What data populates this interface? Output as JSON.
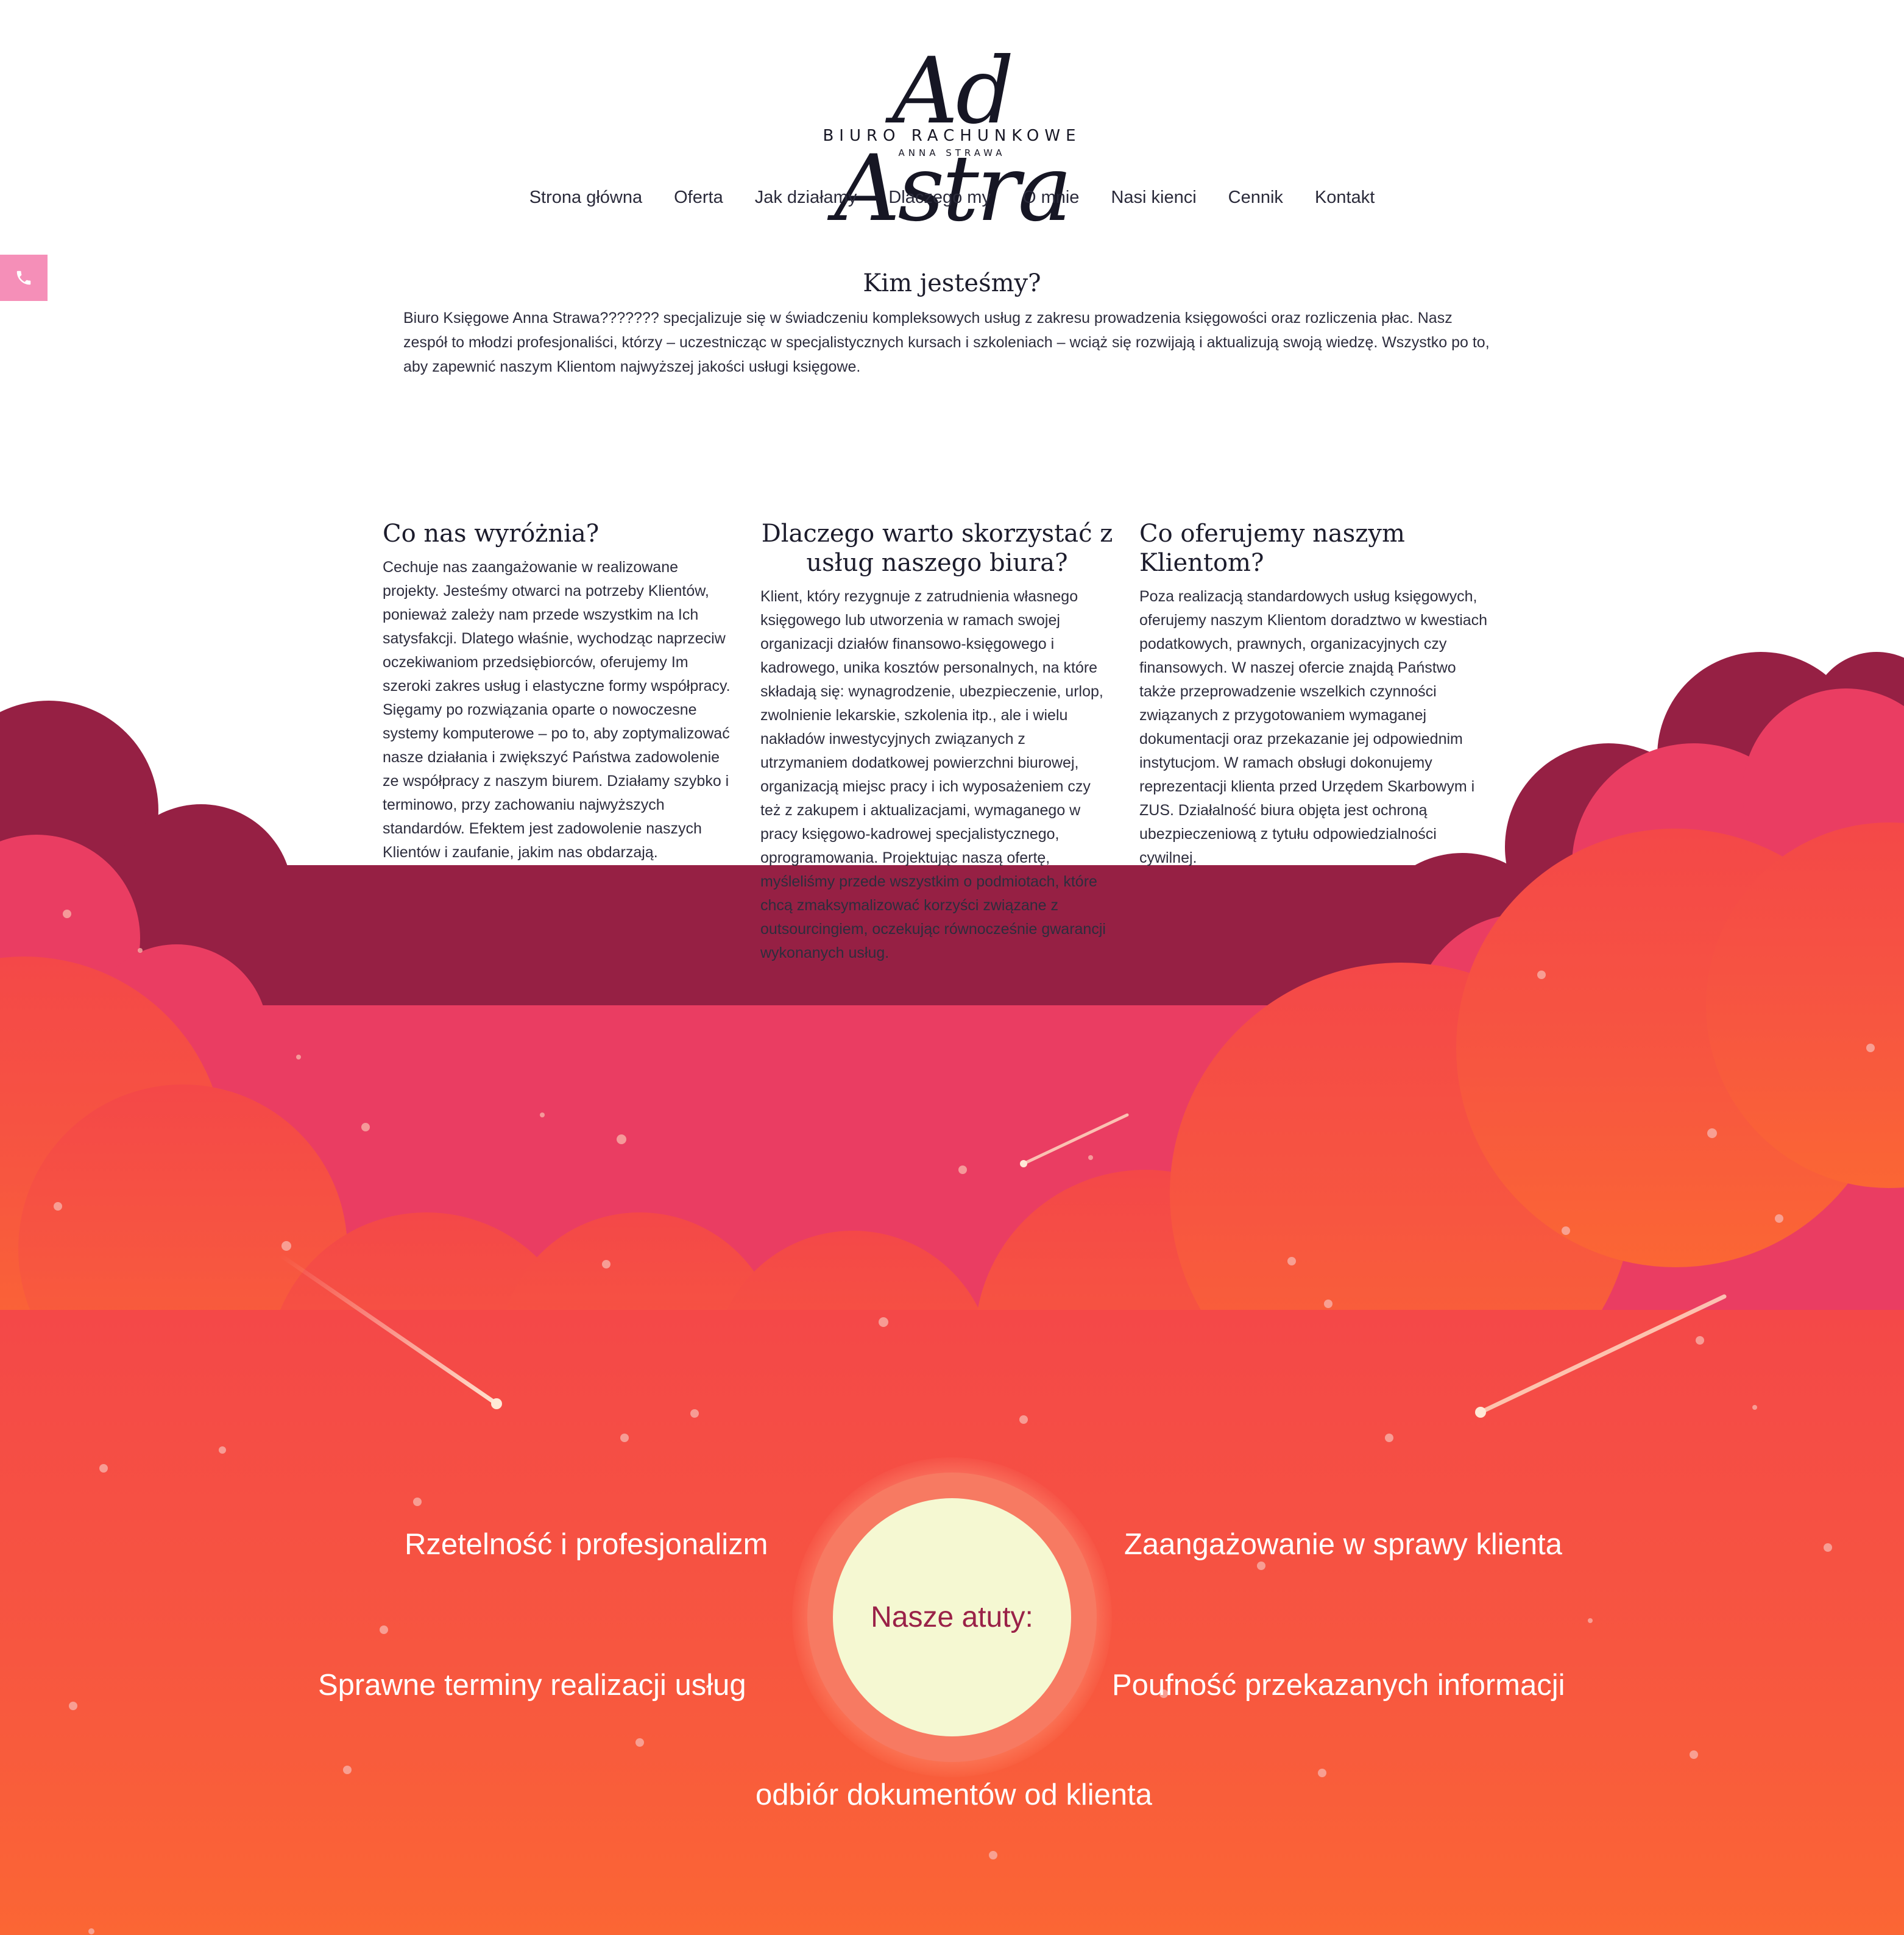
{
  "brand": {
    "logo_script": "Ad Astra",
    "logo_subtitle": "BIURO RACHUNKOWE",
    "logo_owner": "ANNA STRAWA"
  },
  "nav": {
    "items": [
      {
        "label": "Strona główna"
      },
      {
        "label": "Oferta"
      },
      {
        "label": "Jak działamy"
      },
      {
        "label": "Dlaczego my"
      },
      {
        "label": "O mnie"
      },
      {
        "label": "Nasi kienci"
      },
      {
        "label": "Cennik"
      },
      {
        "label": "Kontakt"
      }
    ]
  },
  "phone_tab": {
    "icon": "phone-icon",
    "color": "#f58fb8"
  },
  "intro": {
    "title": "Kim jesteśmy?",
    "text": "Biuro Księgowe Anna Strawa??????? specjalizuje się w świadczeniu kompleksowych usług z zakresu prowadzenia księgowości oraz rozliczenia płac. Nasz zespół to młodzi profesjonaliści, którzy – uczestnicząc w specjalistycznych kursach i szkoleniach – wciąż się rozwijają i aktualizują swoją wiedzę. Wszystko po to, aby zapewnić naszym Klientom najwyższej jakości usługi księgowe."
  },
  "columns": [
    {
      "title": "Co nas wyróżnia?",
      "text": "Cechuje nas zaangażowanie w realizowane projekty. Jesteśmy otwarci na potrzeby Klientów, ponieważ zależy nam przede wszystkim na Ich satysfakcji. Dlatego właśnie, wychodząc naprzeciw oczekiwaniom przedsiębiorców, oferujemy Im szeroki zakres usług i elastyczne formy współpracy. Sięgamy po rozwiązania oparte o nowoczesne systemy komputerowe – po to, aby zoptymalizować nasze działania i zwiększyć Państwa zadowolenie ze współpracy z naszym biurem. Działamy szybko i terminowo, przy zachowaniu najwyższych standardów. Efektem jest zadowolenie naszych Klientów i zaufanie, jakim nas obdarzają."
    },
    {
      "title": "Dlaczego warto skorzystać z usług naszego biura?",
      "text": "Klient, który rezygnuje z zatrudnienia własnego księgowego lub utworzenia w ramach swojej organizacji działów finansowo-księgowego i kadrowego, unika kosztów personalnych, na które składają się: wynagrodzenie, ubezpieczenie, urlop, zwolnienie lekarskie, szkolenia itp., ale i wielu nakładów inwestycyjnych związanych z utrzymaniem dodatkowej powierzchni biurowej, organizacją miejsc pracy i ich wyposażeniem czy też z zakupem i aktualizacjami, wymaganego w pracy księgowo-kadrowej specjalistycznego, oprogramowania. Projektując naszą ofertę, myśleliśmy przede wszystkim o podmiotach, które chcą zmaksymalizować korzyści związane z outsourcingiem, oczekując równocześnie gwarancji wykonanych usług."
    },
    {
      "title": "Co oferujemy naszym Klientom?",
      "text": "Poza realizacją standardowych usług księgowych, oferujemy naszym Klientom doradztwo w kwestiach podatkowych, prawnych, organizacyjnych czy finansowych. W naszej ofercie znajdą Państwo także przeprowadzenie wszelkich czynności związanych z przygotowaniem wymaganej dokumentacji oraz przekazanie jej odpowiednim instytucjom. W ramach obsługi dokonujemy reprezentacji klienta przed Urzędem Skarbowym i ZUS. Działalność biura objęta jest ochroną ubezpieczeniową z tytułu odpowiedzialności cywilnej."
    }
  ],
  "atuty": {
    "center_label": "Nasze atuty:",
    "items": [
      "Rzetelność i profesjonalizm",
      "Zaangażowanie w sprawy klienta",
      "Sprawne terminy realizacji usług",
      "Poufność przekazanych informacji",
      "odbiór dokumentów od klienta"
    ]
  },
  "colors": {
    "cloud_dark": "#962044",
    "cloud_pink": "#ea3d62",
    "cloud_red": "#f44848",
    "bottom_orange": "#fb6634",
    "sun": "#f5f8d2",
    "sun_ring": "#f77a62",
    "accent_text": "#9a2248"
  }
}
